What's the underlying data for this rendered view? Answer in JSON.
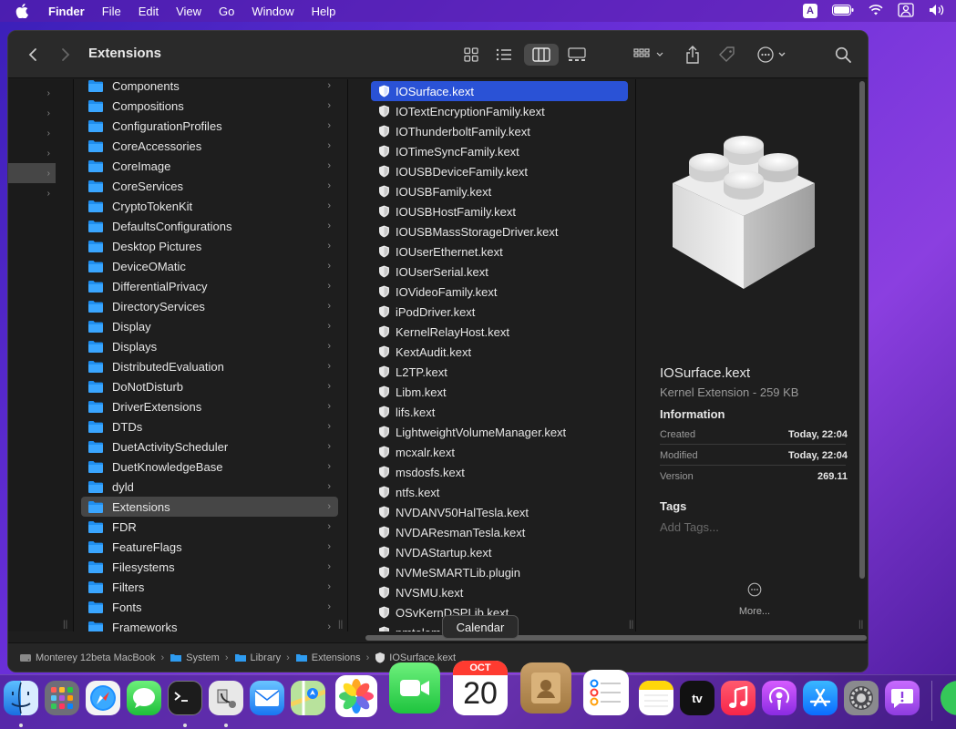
{
  "menubar": {
    "app": "Finder",
    "items": [
      "File",
      "Edit",
      "View",
      "Go",
      "Window",
      "Help"
    ],
    "input_badge": "A"
  },
  "window": {
    "title": "Extensions"
  },
  "column2": {
    "items": [
      {
        "label": "Components"
      },
      {
        "label": "Compositions"
      },
      {
        "label": "ConfigurationProfiles"
      },
      {
        "label": "CoreAccessories"
      },
      {
        "label": "CoreImage"
      },
      {
        "label": "CoreServices"
      },
      {
        "label": "CryptoTokenKit"
      },
      {
        "label": "DefaultsConfigurations"
      },
      {
        "label": "Desktop Pictures"
      },
      {
        "label": "DeviceOMatic"
      },
      {
        "label": "DifferentialPrivacy"
      },
      {
        "label": "DirectoryServices"
      },
      {
        "label": "Display"
      },
      {
        "label": "Displays"
      },
      {
        "label": "DistributedEvaluation"
      },
      {
        "label": "DoNotDisturb"
      },
      {
        "label": "DriverExtensions"
      },
      {
        "label": "DTDs"
      },
      {
        "label": "DuetActivityScheduler"
      },
      {
        "label": "DuetKnowledgeBase"
      },
      {
        "label": "dyld"
      },
      {
        "label": "Extensions",
        "selected": true
      },
      {
        "label": "FDR"
      },
      {
        "label": "FeatureFlags"
      },
      {
        "label": "Filesystems"
      },
      {
        "label": "Filters"
      },
      {
        "label": "Fonts"
      },
      {
        "label": "Frameworks"
      }
    ]
  },
  "column3": {
    "items": [
      {
        "label": "IOSurface.kext",
        "selected": true
      },
      {
        "label": "IOTextEncryptionFamily.kext"
      },
      {
        "label": "IOThunderboltFamily.kext"
      },
      {
        "label": "IOTimeSyncFamily.kext"
      },
      {
        "label": "IOUSBDeviceFamily.kext"
      },
      {
        "label": "IOUSBFamily.kext"
      },
      {
        "label": "IOUSBHostFamily.kext"
      },
      {
        "label": "IOUSBMassStorageDriver.kext"
      },
      {
        "label": "IOUserEthernet.kext"
      },
      {
        "label": "IOUserSerial.kext"
      },
      {
        "label": "IOVideoFamily.kext"
      },
      {
        "label": "iPodDriver.kext"
      },
      {
        "label": "KernelRelayHost.kext"
      },
      {
        "label": "KextAudit.kext"
      },
      {
        "label": "L2TP.kext"
      },
      {
        "label": "Libm.kext"
      },
      {
        "label": "lifs.kext"
      },
      {
        "label": "LightweightVolumeManager.kext"
      },
      {
        "label": "mcxalr.kext"
      },
      {
        "label": "msdosfs.kext"
      },
      {
        "label": "ntfs.kext"
      },
      {
        "label": "NVDANV50HalTesla.kext"
      },
      {
        "label": "NVDAResmanTesla.kext"
      },
      {
        "label": "NVDAStartup.kext"
      },
      {
        "label": "NVMeSMARTLib.plugin"
      },
      {
        "label": "NVSMU.kext"
      },
      {
        "label": "OSvKernDSPLib.kext"
      },
      {
        "label": "pmtelem"
      }
    ]
  },
  "preview": {
    "name": "IOSurface.kext",
    "kind": "Kernel Extension - 259 KB",
    "info_heading": "Information",
    "rows": [
      {
        "label": "Created",
        "value": "Today, 22:04"
      },
      {
        "label": "Modified",
        "value": "Today, 22:04"
      },
      {
        "label": "Version",
        "value": "269.11"
      }
    ],
    "tags_heading": "Tags",
    "tags_placeholder": "Add Tags...",
    "more_label": "More..."
  },
  "pathbar": {
    "items": [
      "Monterey 12beta MacBook",
      "System",
      "Library",
      "Extensions",
      "IOSurface.kext"
    ]
  },
  "tooltip": "Calendar",
  "dock": {
    "calendar_month": "OCT",
    "calendar_day": "20"
  }
}
